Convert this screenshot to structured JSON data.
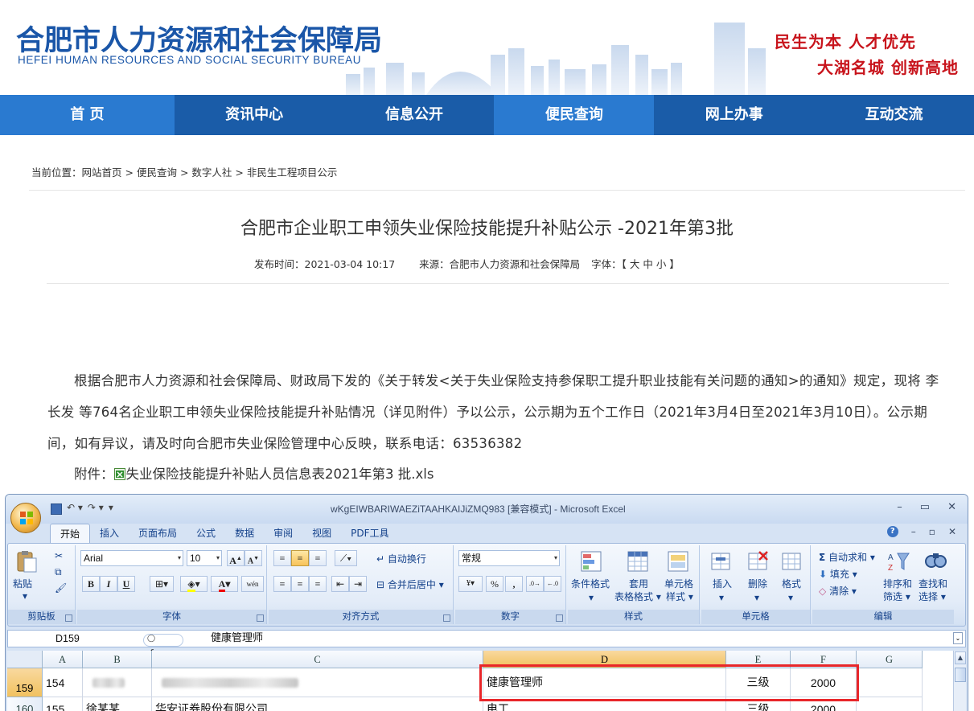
{
  "header": {
    "logo_cn": "合肥市人力资源和社会保障局",
    "logo_en": "HEFEI HUMAN RESOURCES AND SOCIAL SECURITY BUREAU",
    "slogan1": "民生为本 人才优先",
    "slogan2": "大湖名城 创新高地"
  },
  "nav": [
    "首 页",
    "资讯中心",
    "信息公开",
    "便民查询",
    "网上办事",
    "互动交流"
  ],
  "breadcrumb": {
    "prefix": "当前位置：",
    "items": [
      "网站首页",
      "便民查询",
      "数字人社",
      "非民生工程项目公示"
    ],
    "sep": " > "
  },
  "article": {
    "title": "合肥市企业职工申领失业保险技能提升补贴公示 -2021年第3批",
    "publish_label": "发布时间：2021-03-04 10:17",
    "source_label": "来源：合肥市人力资源和社会保障局",
    "font_label": "字体：【 大 中 小 】",
    "body": "根据合肥市人力资源和社会保障局、财政局下发的《关于转发<关于失业保险支持参保职工提升职业技能有关问题的通知>的通知》规定，现将 李长发 等764名企业职工申领失业保险技能提升补贴情况（详见附件）予以公示，公示期为五个工作日（2021年3月4日至2021年3月10日）。公示期间，如有异议，请及时向合肥市失业保险管理中心反映，联系电话：63536382",
    "attach_label": "附件：",
    "attach_name": "失业保险技能提升补贴人员信息表2021年第3 批.xls"
  },
  "excel": {
    "caption": "wKgEIWBARIWAEZiTAAHKAIJiZMQ983  [兼容模式] - Microsoft Excel",
    "tabs": [
      "开始",
      "插入",
      "页面布局",
      "公式",
      "数据",
      "审阅",
      "视图",
      "PDF工具"
    ],
    "groups": {
      "clipboard": "剪贴板",
      "font": "字体",
      "align": "对齐方式",
      "number": "数字",
      "style": "样式",
      "cells": "单元格",
      "edit": "编辑"
    },
    "paste": "粘贴",
    "font_name": "Arial",
    "font_size": "10",
    "wrap": "自动换行",
    "merge": "合并后居中",
    "number_format": "常规",
    "cond_format": "条件格式",
    "table_format_1": "套用",
    "table_format_2": "表格格式",
    "cell_style_1": "单元格",
    "cell_style_2": "样式",
    "insert": "插入",
    "delete": "删除",
    "format": "格式",
    "autosum": "自动求和",
    "fill": "填充",
    "clear": "清除",
    "sort_1": "排序和",
    "sort_2": "筛选",
    "find_1": "查找和",
    "find_2": "选择",
    "name_box": "D159",
    "formula": "健康管理师",
    "columns": [
      "A",
      "B",
      "C",
      "D",
      "E",
      "F",
      "G"
    ],
    "rows": [
      {
        "hdr": "159",
        "a": "154",
        "d": "健康管理师",
        "e": "三级",
        "f": "2000"
      },
      {
        "hdr": "160",
        "a": "155",
        "b": "徐某某",
        "c": "华安证券股份有限公司",
        "d": "电工",
        "e": "三级",
        "f": "2000"
      }
    ]
  },
  "colors": {
    "brand_blue": "#1a56a8",
    "nav_blue": "#1a5ca8",
    "nav_active": "#2a7ad0",
    "slogan_red": "#c8141c",
    "highlight_red": "#e8262a"
  }
}
